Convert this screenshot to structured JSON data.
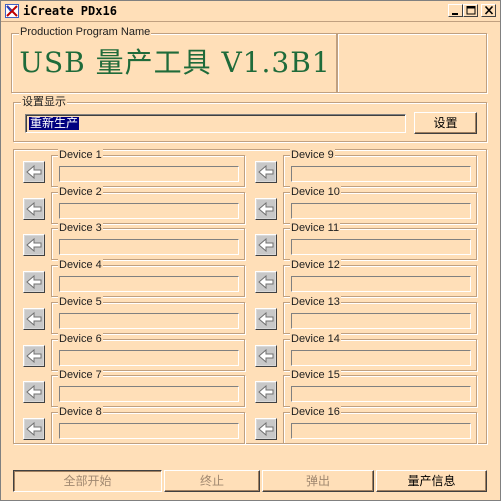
{
  "window": {
    "title": "iCreate PDx16",
    "colors": {
      "background": "#ffdfb8",
      "title_green": "#1f6b3a",
      "selection": "#000080"
    }
  },
  "program_group": {
    "label": "Production Program Name",
    "title": "USB 量产工具 V1.3B1"
  },
  "settings_group": {
    "label": "设置显示",
    "value": "重新生产",
    "button_label": "设置"
  },
  "devices": [
    {
      "label": "Device 1"
    },
    {
      "label": "Device 2"
    },
    {
      "label": "Device 3"
    },
    {
      "label": "Device 4"
    },
    {
      "label": "Device 5"
    },
    {
      "label": "Device 6"
    },
    {
      "label": "Device 7"
    },
    {
      "label": "Device 8"
    },
    {
      "label": "Device 9"
    },
    {
      "label": "Device 10"
    },
    {
      "label": "Device 11"
    },
    {
      "label": "Device 12"
    },
    {
      "label": "Device 13"
    },
    {
      "label": "Device 14"
    },
    {
      "label": "Device 15"
    },
    {
      "label": "Device 16"
    }
  ],
  "device_icon": "arrow-left-icon",
  "bottom_buttons": {
    "start_all": "全部开始",
    "stop": "终止",
    "eject": "弹出",
    "info": "量产信息"
  }
}
